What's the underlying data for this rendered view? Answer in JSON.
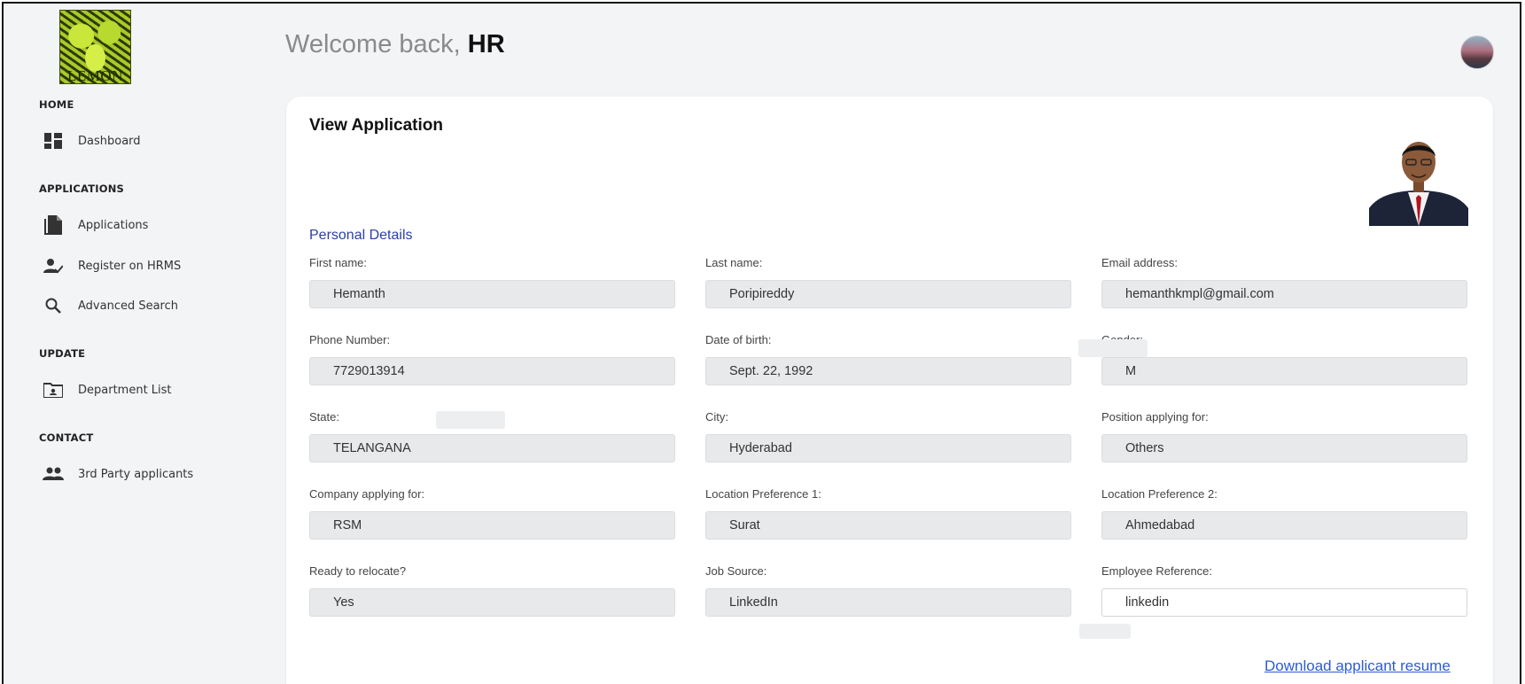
{
  "sidebar": {
    "logo_text": "LEMON",
    "sections": [
      {
        "title": "HOME",
        "items": [
          {
            "label": "Dashboard",
            "icon": "dashboard-icon"
          }
        ]
      },
      {
        "title": "APPLICATIONS",
        "items": [
          {
            "label": "Applications",
            "icon": "document-icon"
          },
          {
            "label": "Register on HRMS",
            "icon": "person-check-icon"
          },
          {
            "label": "Advanced Search",
            "icon": "search-icon"
          }
        ]
      },
      {
        "title": "UPDATE",
        "items": [
          {
            "label": "Department List",
            "icon": "folder-user-icon"
          }
        ]
      },
      {
        "title": "CONTACT",
        "items": [
          {
            "label": "3rd Party applicants",
            "icon": "group-icon"
          }
        ]
      }
    ]
  },
  "header": {
    "welcome_prefix": "Welcome back, ",
    "user": "HR"
  },
  "card": {
    "title": "View Application",
    "section_title": "Personal Details",
    "fields": [
      {
        "label": "First name:",
        "value": "Hemanth"
      },
      {
        "label": "Last name:",
        "value": "Poripireddy"
      },
      {
        "label": "Email address:",
        "value": "hemanthkmpl@gmail.com"
      },
      {
        "label": "Phone Number:",
        "value": "7729013914"
      },
      {
        "label": "Date of birth:",
        "value": "Sept. 22, 1992"
      },
      {
        "label": "Gender:",
        "value": "M"
      },
      {
        "label": "State:",
        "value": "TELANGANA"
      },
      {
        "label": "City:",
        "value": "Hyderabad"
      },
      {
        "label": "Position applying for:",
        "value": "Others"
      },
      {
        "label": "Company applying for:",
        "value": "RSM"
      },
      {
        "label": "Location Preference 1:",
        "value": "Surat"
      },
      {
        "label": "Location Preference 2:",
        "value": "Ahmedabad"
      },
      {
        "label": "Ready to relocate?",
        "value": "Yes"
      },
      {
        "label": "Job Source:",
        "value": "LinkedIn"
      },
      {
        "label": "Employee Reference:",
        "value": "linkedin"
      }
    ],
    "download_link": "Download applicant resume"
  },
  "colors": {
    "accent": "#2b3fa8",
    "link": "#2a5bd7",
    "page_bg": "#f3f4f6",
    "field_bg": "#e8e9eb"
  }
}
